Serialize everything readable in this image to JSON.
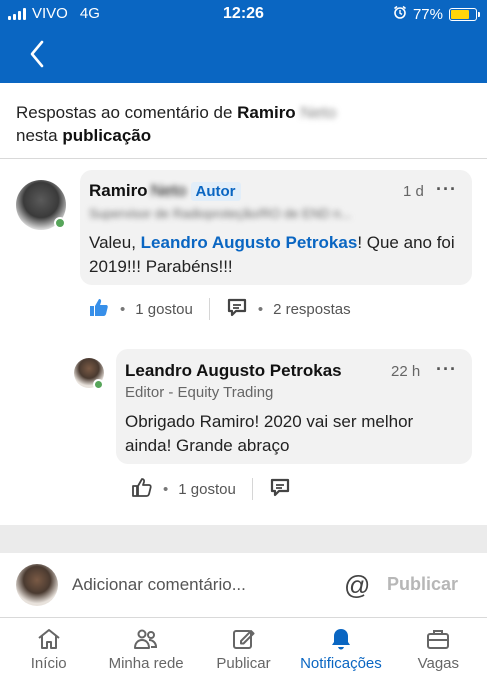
{
  "status_bar": {
    "carrier": "VIVO",
    "network": "4G",
    "time": "12:26",
    "battery": "77%",
    "battery_level": 0.77
  },
  "context": {
    "prefix": "Respostas ao comentário de ",
    "author": "Ramiro",
    "author_surname": "Neto",
    "middle": "nesta ",
    "link": "publicação"
  },
  "comment": {
    "author": "Ramiro",
    "author_surname": "Neto",
    "badge": "Autor",
    "time": "1 d",
    "more": "···",
    "headline": "Supervisor de Radioproteção/RO de END n...",
    "text_before": "Valeu, ",
    "mention": "Leandro Augusto Petrokas",
    "text_after": "! Que ano foi 2019!!! Parabéns!!!",
    "likes": "1 gostou",
    "replies": "2 respostas",
    "dot": "•"
  },
  "reply": {
    "author": "Leandro Augusto Petrokas",
    "time": "22 h",
    "more": "···",
    "headline": "Editor - Equity Trading",
    "text": "Obrigado Ramiro! 2020 vai ser melhor ainda! Grande abraço",
    "likes": "1 gostou",
    "dot": "•"
  },
  "composer": {
    "placeholder": "Adicionar comentário...",
    "at": "@",
    "publish": "Publicar"
  },
  "nav": {
    "tabs": [
      {
        "label": "Início",
        "icon": "home-icon"
      },
      {
        "label": "Minha rede",
        "icon": "network-icon"
      },
      {
        "label": "Publicar",
        "icon": "post-icon"
      },
      {
        "label": "Notificações",
        "icon": "bell-icon",
        "active": true
      },
      {
        "label": "Vagas",
        "icon": "briefcase-icon"
      }
    ]
  },
  "colors": {
    "brand": "#0a66c2",
    "presence": "#57a55a",
    "battery": "#ffd60a"
  }
}
